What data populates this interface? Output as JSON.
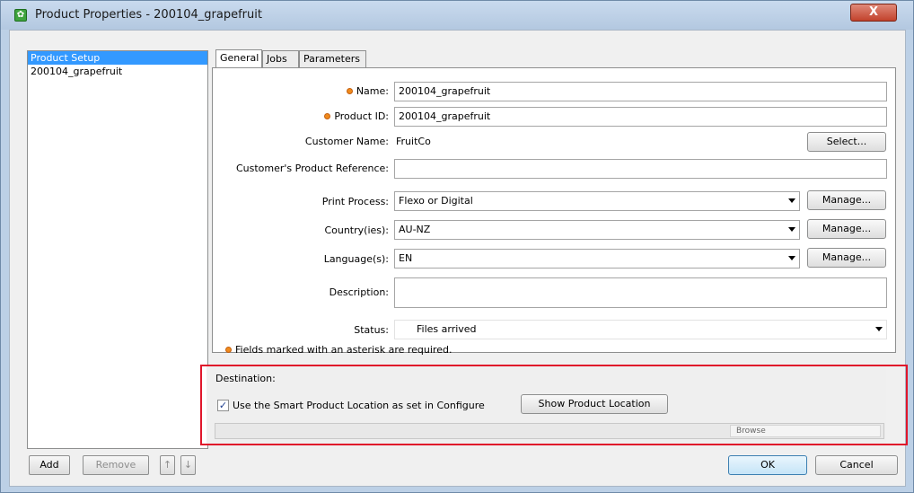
{
  "window": {
    "title": "Product Properties - 200104_grapefruit",
    "close_symbol": "X"
  },
  "sidebar": {
    "items": [
      "Product Setup",
      "200104_grapefruit"
    ],
    "add_label": "Add",
    "remove_label": "Remove",
    "move_up_symbol": "↑",
    "move_down_symbol": "↓"
  },
  "tabs": [
    "General",
    "Jobs",
    "Parameters"
  ],
  "form": {
    "name_label": "Name:",
    "name_value": "200104_grapefruit",
    "product_id_label": "Product ID:",
    "product_id_value": "200104_grapefruit",
    "customer_name_label": "Customer Name:",
    "customer_name_value": "FruitCo",
    "select_label": "Select...",
    "customer_ref_label": "Customer's Product Reference:",
    "customer_ref_value": "",
    "print_process_label": "Print Process:",
    "print_process_value": "Flexo or Digital",
    "countries_label": "Country(ies):",
    "countries_value": "AU-NZ",
    "languages_label": "Language(s):",
    "languages_value": "EN",
    "manage_label": "Manage...",
    "description_label": "Description:",
    "description_value": "",
    "status_label": "Status:",
    "status_value": "Files arrived",
    "required_note": "Fields marked with an asterisk are required."
  },
  "destination": {
    "label": "Destination:",
    "checkbox_checked": true,
    "checkbox_label": "Use the Smart Product Location as set in Configure",
    "show_location_label": "Show Product Location",
    "browse_label": "Browse"
  },
  "footer": {
    "ok_label": "OK",
    "cancel_label": "Cancel"
  },
  "colors": {
    "selection": "#3399ff",
    "required_marker": "#f08a1c",
    "highlight": "#e0162b"
  }
}
